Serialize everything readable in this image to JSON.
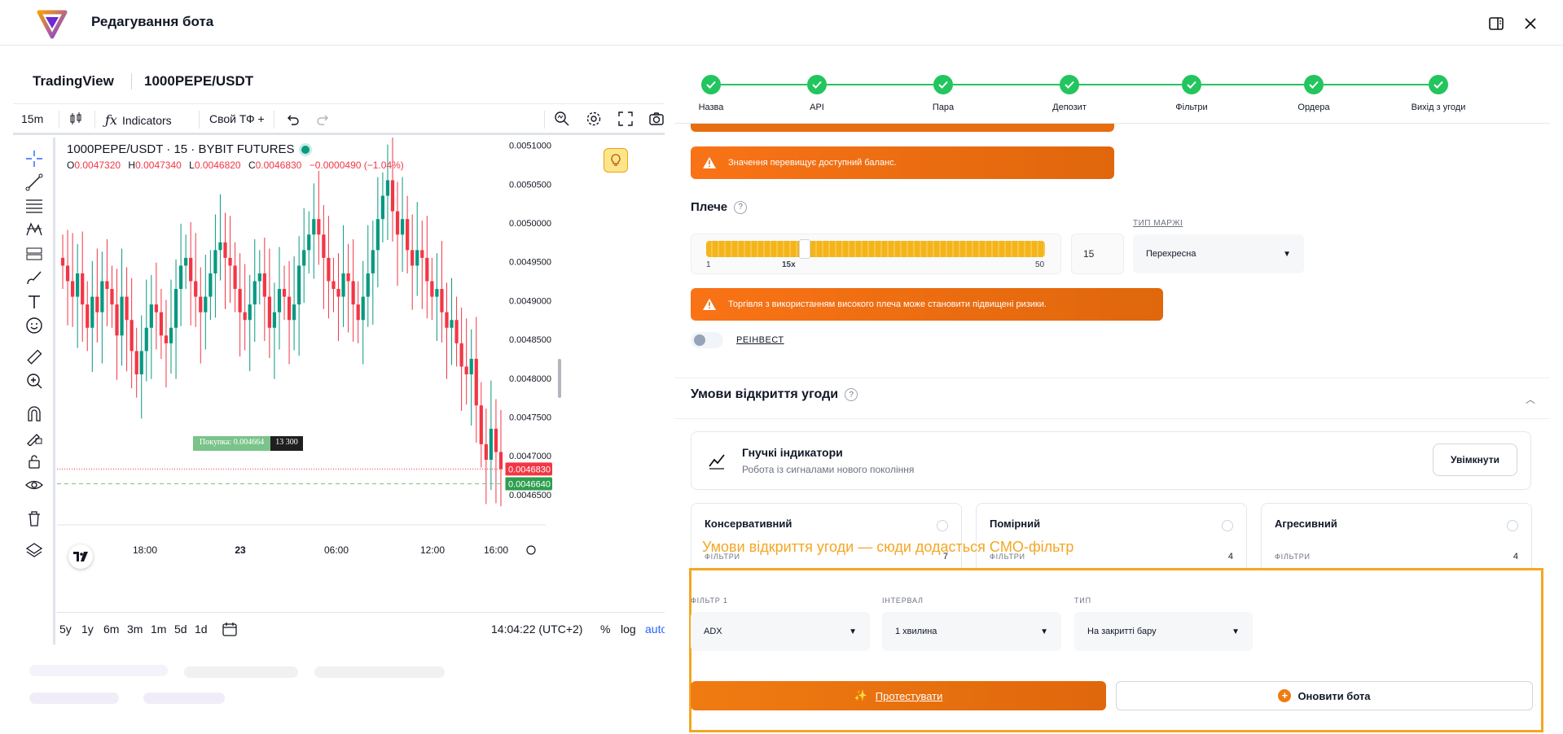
{
  "app": {
    "title": "Редагування бота"
  },
  "tv": {
    "brand": "TradingView",
    "symbol": "1000PEPE/USDT",
    "toolbar": {
      "timeframe": "15m",
      "indicators": "Indicators",
      "custom_tf": "Свой ТФ +"
    },
    "legend": {
      "title": "1000PEPE/USDT · 15 · BYBIT FUTURES",
      "o_label": "O",
      "o": "0.0047320",
      "h_label": "H",
      "h": "0.0047340",
      "l_label": "L",
      "l": "0.0046820",
      "c_label": "C",
      "c": "0.0046830",
      "change": "−0.0000490 (−1.04%)"
    },
    "order": {
      "buy": "Покупка: 0.004664",
      "qty": "13 300"
    },
    "bottom": {
      "ranges": [
        "5y",
        "1y",
        "6m",
        "3m",
        "1m",
        "5d",
        "1d"
      ],
      "time": "14:04:22 (UTC+2)",
      "pct": "%",
      "log": "log",
      "auto": "auto"
    }
  },
  "chart_data": {
    "type": "candlestick",
    "title": "1000PEPE/USDT · 15 · BYBIT FUTURES",
    "y_ticks": [
      "0.0051000",
      "0.0050500",
      "0.0050000",
      "0.0049500",
      "0.0049000",
      "0.0048500",
      "0.0048000",
      "0.0047500",
      "0.0047000",
      "0.0046500"
    ],
    "x_ticks": [
      "18:00",
      "23",
      "06:00",
      "12:00",
      "16:00"
    ],
    "ylim": [
      0.00463,
      0.00511
    ],
    "last_price": "0.0046830",
    "order_price": "0.0046640",
    "colors": {
      "up": "#089981",
      "down": "#f23645"
    },
    "close_series": [
      0.004945,
      0.004925,
      0.004905,
      0.004935,
      0.004895,
      0.004865,
      0.004905,
      0.004885,
      0.004925,
      0.004915,
      0.004895,
      0.004855,
      0.004905,
      0.004875,
      0.004835,
      0.004805,
      0.004835,
      0.004865,
      0.004895,
      0.004885,
      0.004855,
      0.004845,
      0.004865,
      0.004915,
      0.004945,
      0.004955,
      0.004925,
      0.004905,
      0.004885,
      0.004905,
      0.004935,
      0.004965,
      0.004975,
      0.004955,
      0.004945,
      0.004915,
      0.004885,
      0.004875,
      0.004895,
      0.004925,
      0.004935,
      0.004905,
      0.004865,
      0.004885,
      0.004915,
      0.004905,
      0.004875,
      0.004895,
      0.004945,
      0.004965,
      0.004985,
      0.005005,
      0.004985,
      0.004955,
      0.004925,
      0.004915,
      0.004905,
      0.004935,
      0.004925,
      0.004895,
      0.004875,
      0.004905,
      0.004935,
      0.004965,
      0.005005,
      0.005035,
      0.005055,
      0.005015,
      0.004985,
      0.005005,
      0.004965,
      0.004945,
      0.004965,
      0.004955,
      0.004925,
      0.004905,
      0.004915,
      0.004885,
      0.004865,
      0.004875,
      0.004845,
      0.004815,
      0.004805,
      0.004825,
      0.004765,
      0.004715,
      0.004695,
      0.004735,
      0.004705,
      0.004683
    ]
  },
  "steps": [
    {
      "label": "Назва"
    },
    {
      "label": "API"
    },
    {
      "label": "Пара"
    },
    {
      "label": "Депозит"
    },
    {
      "label": "Фільтри"
    },
    {
      "label": "Ордера"
    },
    {
      "label": "Вихід з угоди"
    }
  ],
  "warnings": {
    "balance": "Значення перевищує доступний баланс.",
    "leverage": "Торгівля з використанням високого плеча може становити підвищені ризики."
  },
  "leverage": {
    "label": "Плече",
    "min": "1",
    "current": "15x",
    "max": "50",
    "value": "15",
    "level_fraction": 0.29
  },
  "margin": {
    "label": "ТИП МАРЖІ",
    "value": "Перехресна"
  },
  "reinvest": {
    "label": "РЕІНВЕСТ"
  },
  "open_conditions": {
    "title": "Умови відкриття угоди",
    "flex": {
      "title": "Гнучкі індикатори",
      "subtitle": "Робота із сигналами нового покоління",
      "button": "Увімкнути"
    },
    "strategies": [
      {
        "name": "Консервативний",
        "filters_label": "ФІЛЬТРИ",
        "filters_count": "7"
      },
      {
        "name": "Помірний",
        "filters_label": "ФІЛЬТРИ",
        "filters_count": "4"
      },
      {
        "name": "Агресивний",
        "filters_label": "ФІЛЬТРИ",
        "filters_count": "4"
      }
    ],
    "caption": "Умови відкриття угоди — сюди додасться CMO-фільтр",
    "filter": {
      "filter_label": "ФІЛЬТР 1",
      "filter_value": "ADX",
      "interval_label": "ІНТЕРВАЛ",
      "interval_value": "1 хвилина",
      "type_label": "ТИП",
      "type_value": "На закритті бару"
    },
    "test_button": "Протестувати",
    "update_button": "Оновити бота"
  }
}
